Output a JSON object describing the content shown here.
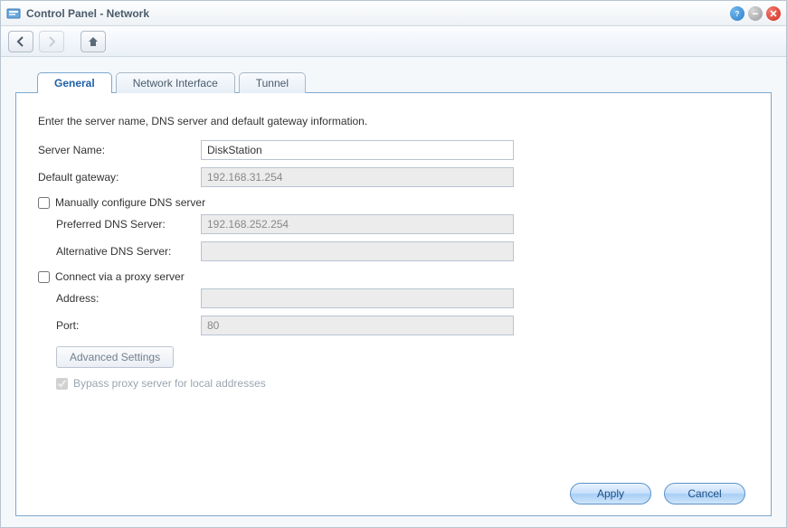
{
  "window": {
    "title": "Control Panel - Network"
  },
  "tabs": [
    {
      "label": "General"
    },
    {
      "label": "Network Interface"
    },
    {
      "label": "Tunnel"
    }
  ],
  "intro": "Enter the server name, DNS server and default gateway information.",
  "labels": {
    "server_name": "Server Name:",
    "default_gateway": "Default gateway:",
    "manual_dns": "Manually configure DNS server",
    "pref_dns": "Preferred DNS Server:",
    "alt_dns": "Alternative DNS Server:",
    "proxy": "Connect via a proxy server",
    "address": "Address:",
    "port": "Port:",
    "advanced": "Advanced Settings",
    "bypass": "Bypass proxy server for local addresses"
  },
  "values": {
    "server_name": "DiskStation",
    "default_gateway": "192.168.31.254",
    "pref_dns": "192.168.252.254",
    "alt_dns": "",
    "proxy_address": "",
    "proxy_port": "80"
  },
  "buttons": {
    "apply": "Apply",
    "cancel": "Cancel"
  }
}
